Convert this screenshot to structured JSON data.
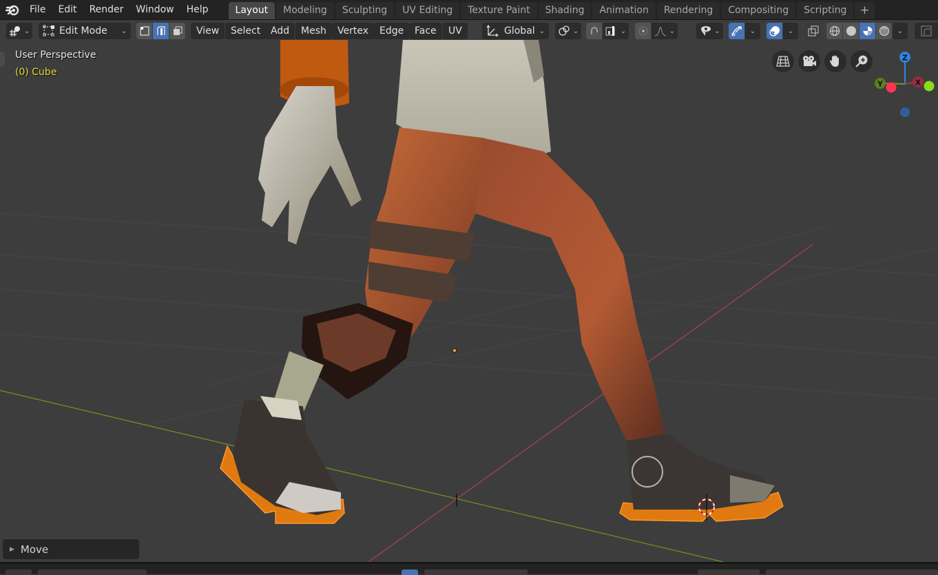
{
  "app": {
    "menu": [
      "File",
      "Edit",
      "Render",
      "Window",
      "Help"
    ],
    "workspaces": [
      "Layout",
      "Modeling",
      "Sculpting",
      "UV Editing",
      "Texture Paint",
      "Shading",
      "Animation",
      "Rendering",
      "Compositing",
      "Scripting"
    ],
    "active_workspace": "Layout",
    "add_workspace_label": "+"
  },
  "header": {
    "editor_type_icon": "object-data-icon",
    "mode": "Edit Mode",
    "select_modes": [
      {
        "name": "vertex-select",
        "active": false
      },
      {
        "name": "edge-select",
        "active": true
      },
      {
        "name": "face-select",
        "active": false
      }
    ],
    "menus": [
      "View",
      "Select",
      "Add",
      "Mesh",
      "Vertex",
      "Edge",
      "Face",
      "UV"
    ],
    "transform_orientation": "Global",
    "pivot_icon": "pivot-icon",
    "snap_icon": "magnet-icon",
    "snap_target_icon": "snap-increment-icon",
    "proportional_icon": "proportional-edit-icon",
    "falloff_icon": "falloff-smooth-icon",
    "visibility_icon": "eye-cursor-icon",
    "gizmo_icon": "gizmo-icon",
    "overlay_icon": "overlay-icon",
    "xray_icon": "xray-icon",
    "shading_modes": [
      {
        "name": "wireframe",
        "active": false
      },
      {
        "name": "solid",
        "active": false
      },
      {
        "name": "material-preview",
        "active": true
      },
      {
        "name": "rendered",
        "active": false
      }
    ]
  },
  "viewport": {
    "view_name": "User Perspective",
    "object_name": "(0) Cube",
    "nav_buttons": [
      "toggle-ortho",
      "camera-view",
      "pan-hand",
      "zoom"
    ],
    "axis_gizmo": {
      "z": "Z",
      "y": "Y",
      "x": "X"
    },
    "colors": {
      "x_axis": "#c7344a",
      "y_axis": "#6e9a1f",
      "z_axis": "#2f83e6",
      "selection": "#ff8c1a",
      "object_label": "#e4df3c"
    }
  },
  "last_operator": {
    "label": "Move",
    "collapsed": true
  }
}
